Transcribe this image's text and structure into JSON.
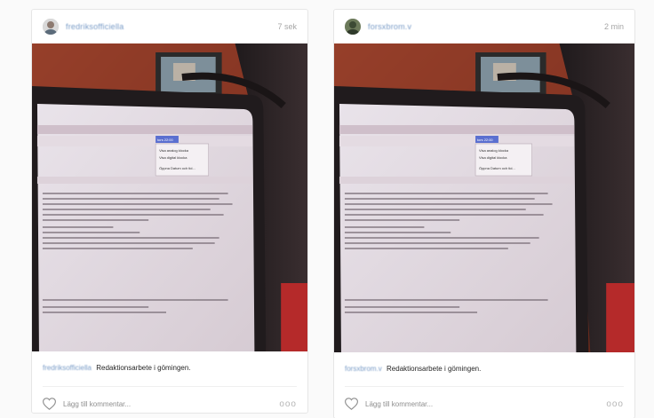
{
  "posts": [
    {
      "username": "fredriksofficiella",
      "timestamp": "7 sek",
      "caption": "Redaktionsarbete i gömingen.",
      "comment_placeholder": "Lägg till kommentar...",
      "more_label": "ooo"
    },
    {
      "username": "forsxbrom.v",
      "timestamp": "2 min",
      "caption": "Redaktionsarbete i gömingen.",
      "comment_placeholder": "Lägg till kommentar...",
      "more_label": "ooo"
    }
  ],
  "screen_menu": {
    "item1": "Visa analog klocka",
    "item2": "Visa digital klocka",
    "item3": "Öppna Datum och tid...",
    "clock": "tors 22:00"
  },
  "colors": {
    "link": "#7a9cc7",
    "text": "#262626",
    "muted": "#8e8e8e",
    "border": "#e6e6e6",
    "background": "#fafafa"
  },
  "icons": {
    "like": "heart-icon",
    "more": "more-options-icon"
  }
}
